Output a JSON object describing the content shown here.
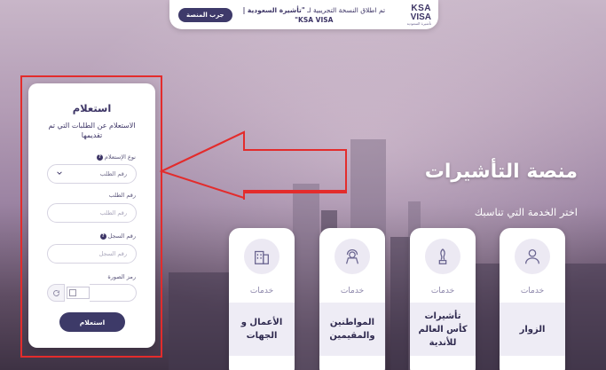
{
  "banner": {
    "logo_line1": "KSA",
    "logo_line2": "VISA",
    "logo_sub": "تأشيرة السعودية",
    "text_prefix": "تم اطلاق النسخة التجريبية لـ ",
    "text_bold": "\"تأشيرة السعودية | KSA VISA\"",
    "try_button": "جرب المنصة"
  },
  "hero": {
    "title": "منصة التأشيرات",
    "subtitle": "اختر الخدمة التي تناسبك"
  },
  "services": [
    {
      "type": "خدمات",
      "name": "الزوار",
      "icon": "visitor-icon"
    },
    {
      "type": "خدمات",
      "name": "تأشيرات كأس العالم للأندية",
      "icon": "trophy-icon"
    },
    {
      "type": "خدمات",
      "name": "المواطنين والمقيمين",
      "icon": "citizen-icon"
    },
    {
      "type": "خدمات",
      "name": "الأعمال و الجهات",
      "icon": "building-icon"
    }
  ],
  "inquiry": {
    "title": "استعلام",
    "description": "الاستعلام عن الطلبات التي تم تقديمها",
    "type_label": "نوع الإستعلام",
    "type_value": "رقم الطلب",
    "request_label": "رقم الطلب",
    "request_placeholder": "رقم الطلب",
    "record_label": "رقم السجل",
    "record_placeholder": "رقم السجل",
    "captcha_label": "رمز الصورة",
    "submit": "استعلام"
  },
  "colors": {
    "primary": "#3d3a68",
    "annotation": "#e32c2c"
  }
}
